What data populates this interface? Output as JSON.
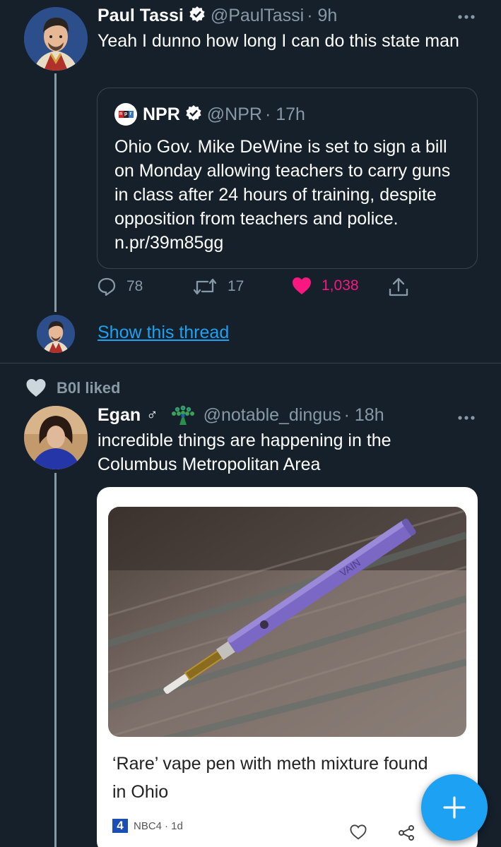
{
  "tweet1": {
    "name": "Paul Tassi",
    "handle": "@PaulTassi",
    "time": "· 9h",
    "text": "Yeah I dunno how long I can do this state man",
    "more_icon": "more-horizontal-icon",
    "quote": {
      "logo_text": "npr",
      "name": "NPR",
      "handle": "@NPR",
      "time": "· 17h",
      "text": "Ohio Gov. Mike DeWine is set to sign a bill on Monday allowing teachers to carry guns in class after 24 hours of training, despite opposition from teachers and police. n.pr/39m85gg"
    },
    "replies": "78",
    "retweets": "17",
    "likes": "1,038",
    "like_color": "#f91880",
    "show_thread": "Show this thread"
  },
  "liked_by": {
    "text": "B0l liked"
  },
  "tweet2": {
    "name": "Egan",
    "symbol": "♂",
    "handle": "@notable_dingus",
    "time": "· 18h",
    "text": "incredible things are happening in the Columbus Metropolitan Area",
    "card": {
      "image_caption": "VAIN",
      "title": "‘Rare’ vape pen with meth mixture found in Ohio",
      "source_logo": "4",
      "source": "NBC4",
      "time": "· 1d"
    }
  },
  "fab": {
    "label": "+"
  },
  "colors": {
    "background": "#15202b",
    "accent": "#1da1f2",
    "secondary_text": "#8899a6",
    "border": "#38444d"
  }
}
